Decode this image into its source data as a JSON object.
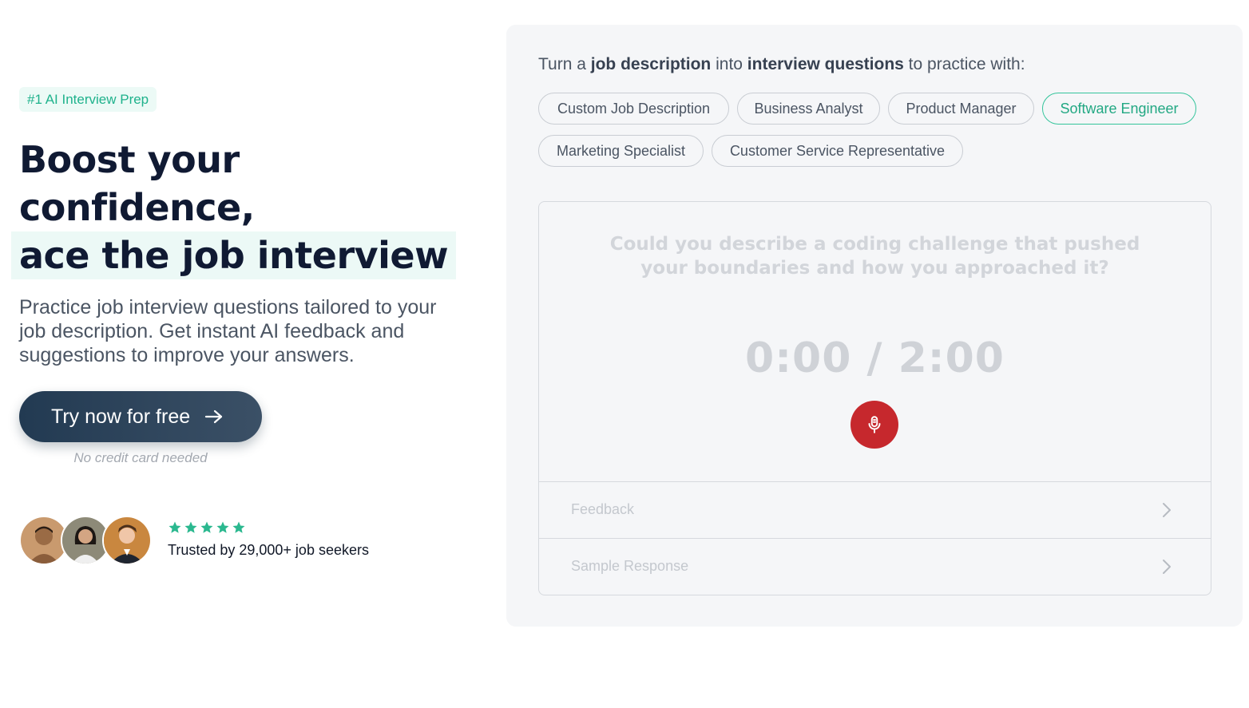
{
  "hero": {
    "badge": "#1 AI Interview Prep",
    "headline_line1": "Boost your",
    "headline_line2": "confidence,",
    "headline_line3": "ace the job interview",
    "subtitle": "Practice job interview questions tailored to your job description. Get instant AI feedback and suggestions to improve your answers.",
    "cta_label": "Try now for free",
    "cta_icon": "arrow-right-icon",
    "cta_note": "No credit card needed",
    "rating_stars": 5,
    "trusted_text": "Trusted by 29,000+ job seekers",
    "colors": {
      "accent": "#1fb28c",
      "heading": "#101a33",
      "cta": "#223a52"
    }
  },
  "panel": {
    "prompt": {
      "p1": "Turn a ",
      "b1": "job description",
      "p2": " into ",
      "b2": "interview questions",
      "p3": " to practice with:"
    },
    "chips": [
      "Custom Job Description",
      "Business Analyst",
      "Product Manager",
      "Software Engineer",
      "Marketing Specialist",
      "Customer Service Representative"
    ],
    "active_chip": "Software Engineer",
    "question": "Could you describe a coding challenge that pushed your boundaries and how you approached it?",
    "timer": "0:00 / 2:00",
    "mic_icon": "microphone-icon",
    "mic_color": "#c6282d",
    "sections": [
      "Feedback",
      "Sample Response"
    ]
  }
}
